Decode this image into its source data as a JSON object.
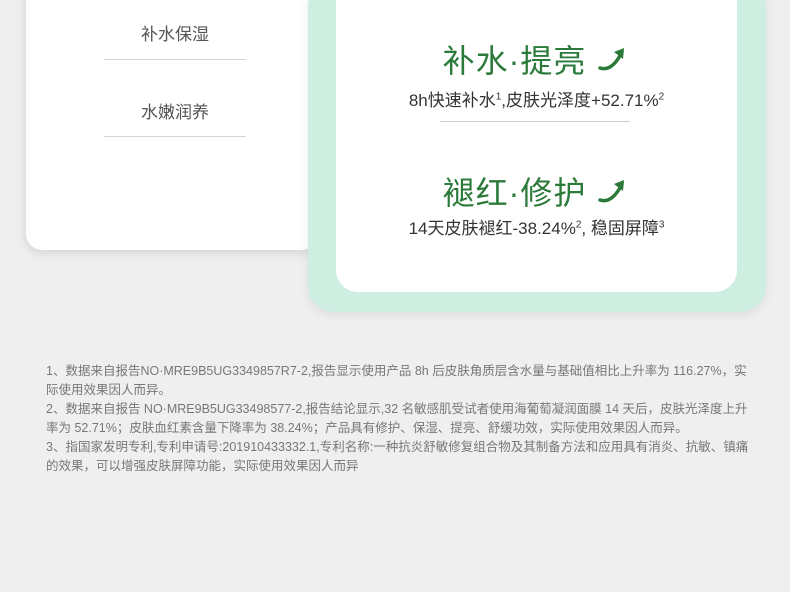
{
  "left_panel": {
    "items": [
      "补水保湿",
      "水嫩润养"
    ]
  },
  "benefits": [
    {
      "title": "补水·提亮",
      "desc_main": "8h快速补水",
      "sup1": "1",
      "desc_rest": ",皮肤光泽度+52.71%",
      "sup2": "2",
      "desc_tail": ""
    },
    {
      "title": "褪红·修护",
      "desc_main": "14天皮肤褪红-38.24%",
      "sup1": "2",
      "desc_rest": ", 稳固屏障",
      "sup2": "3",
      "desc_tail": ""
    }
  ],
  "footnotes": [
    "1、数据来自报告NO·MRE9B5UG3349857R7-2,报告显示使用产品 8h 后皮肤角质层含水量与基础值相比上升率为 116.27%，实际使用效果因人而异。",
    "2、数据来自报告 NO·MRE9B5UG33498577-2,报告结论显示,32 名敏感肌受试者使用海葡萄凝润面膜 14 天后，皮肤光泽度上升率为 52.71%；皮肤血红素含量下降率为 38.24%；产品具有修护、保湿、提亮、舒缓功效，实际使用效果因人而异。",
    "3、指国家发明专利,专利申请号:201910433332.1,专利名称:一种抗炎舒敏修复组合物及其制备方法和应用具有消炎、抗敏、镇痛的效果，可以增强皮肤屏障功能，实际使用效果因人而异"
  ],
  "colors": {
    "accent_green": "#2b7a3a",
    "card_mint": "#cdeee0",
    "background": "#efefef"
  },
  "icons": [
    "arrow-up-right-icon"
  ]
}
